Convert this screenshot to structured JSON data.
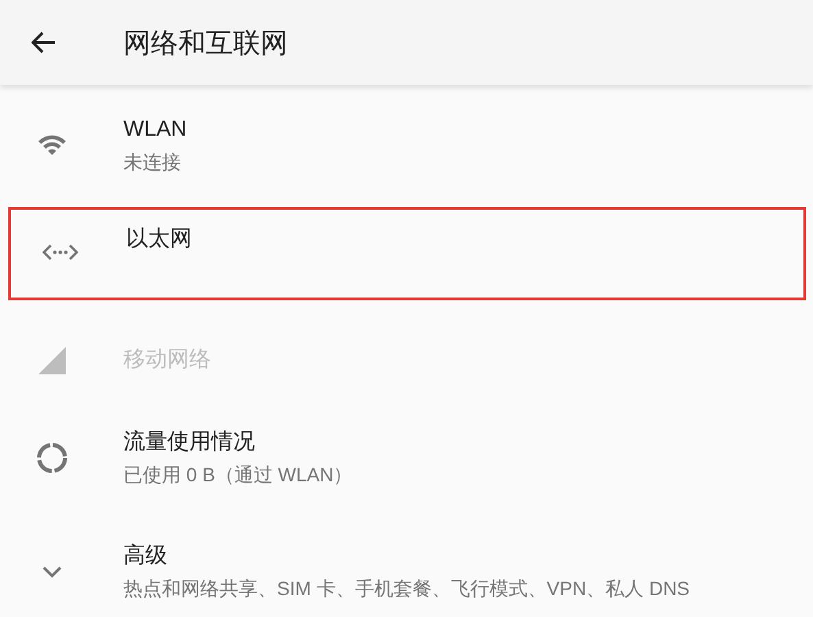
{
  "header": {
    "title": "网络和互联网"
  },
  "items": [
    {
      "kind": "wifi",
      "title": "WLAN",
      "summary": "未连接",
      "disabled": false,
      "highlighted": false
    },
    {
      "kind": "ethernet",
      "title": "以太网",
      "disabled": false,
      "highlighted": true
    },
    {
      "kind": "signal",
      "title": "移动网络",
      "disabled": true,
      "highlighted": false
    },
    {
      "kind": "usage",
      "title": "流量使用情况",
      "summary": "已使用 0 B（通过 WLAN）",
      "disabled": false,
      "highlighted": false
    },
    {
      "kind": "expand",
      "title": "高级",
      "summary": "热点和网络共享、SIM 卡、手机套餐、飞行模式、VPN、私人 DNS",
      "disabled": false,
      "highlighted": false
    }
  ]
}
